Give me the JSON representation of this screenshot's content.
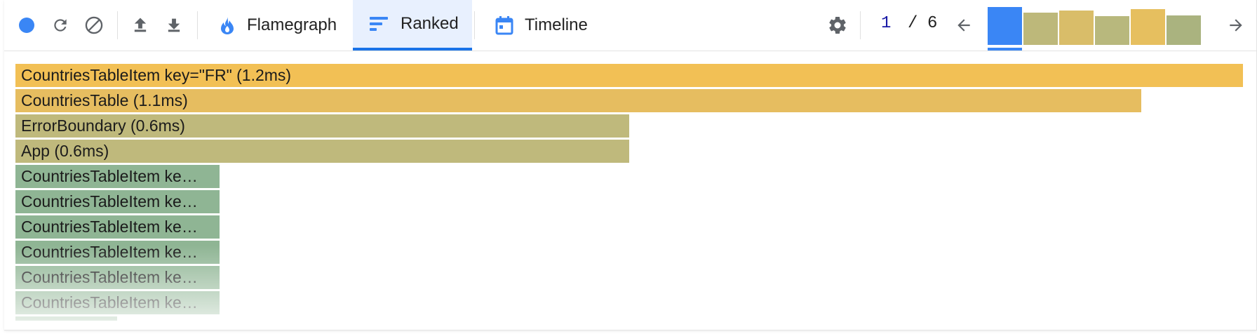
{
  "toolbar": {
    "record_icon": "record-dot-icon",
    "reload_icon": "reload-icon",
    "clear_icon": "clear-icon",
    "import_icon": "import-arrow-up-icon",
    "export_icon": "export-arrow-down-icon",
    "tabs": [
      {
        "label": "Flamegraph",
        "icon": "flame-icon",
        "active": false
      },
      {
        "label": "Ranked",
        "icon": "ranked-bars-icon",
        "active": true
      },
      {
        "label": "Timeline",
        "icon": "calendar-icon",
        "active": false
      }
    ],
    "settings_icon": "gear-icon",
    "commit_current": "1",
    "commit_separator": "/",
    "commit_total": "6",
    "prev_icon": "arrow-left-icon",
    "next_icon": "arrow-right-icon"
  },
  "commit_bars": [
    {
      "level": 1.0,
      "color": "#3a86f5",
      "selected": true
    },
    {
      "level": 0.85,
      "color": "#bdb87a"
    },
    {
      "level": 0.9,
      "color": "#d9bd69"
    },
    {
      "level": 0.75,
      "color": "#b8b87d"
    },
    {
      "level": 0.95,
      "color": "#e6bf5f"
    },
    {
      "level": 0.78,
      "color": "#aab37f"
    }
  ],
  "ranked": [
    {
      "label": "CountriesTableItem key=\"FR\" (1.2ms)",
      "share": 1.0,
      "color": "#f2c055"
    },
    {
      "label": "CountriesTable (1.1ms)",
      "share": 0.917,
      "color": "#e6bd60"
    },
    {
      "label": "ErrorBoundary (0.6ms)",
      "share": 0.5,
      "color": "#bfb97c"
    },
    {
      "label": "App (0.6ms)",
      "share": 0.5,
      "color": "#bfb97c"
    },
    {
      "label": "CountriesTableItem ke…",
      "share": 0.166,
      "color": "#8fb594"
    },
    {
      "label": "CountriesTableItem ke…",
      "share": 0.166,
      "color": "#8fb594"
    },
    {
      "label": "CountriesTableItem ke…",
      "share": 0.166,
      "color": "#8fb594"
    },
    {
      "label": "CountriesTableItem ke…",
      "share": 0.166,
      "color": "#8fb594"
    },
    {
      "label": "CountriesTableItem ke…",
      "share": 0.166,
      "color": "#8fb594"
    },
    {
      "label": "CountriesTableItem ke…",
      "share": 0.166,
      "color": "#8fb594"
    },
    {
      "label": "",
      "share": 0.083,
      "color": "#8fb594"
    }
  ]
}
